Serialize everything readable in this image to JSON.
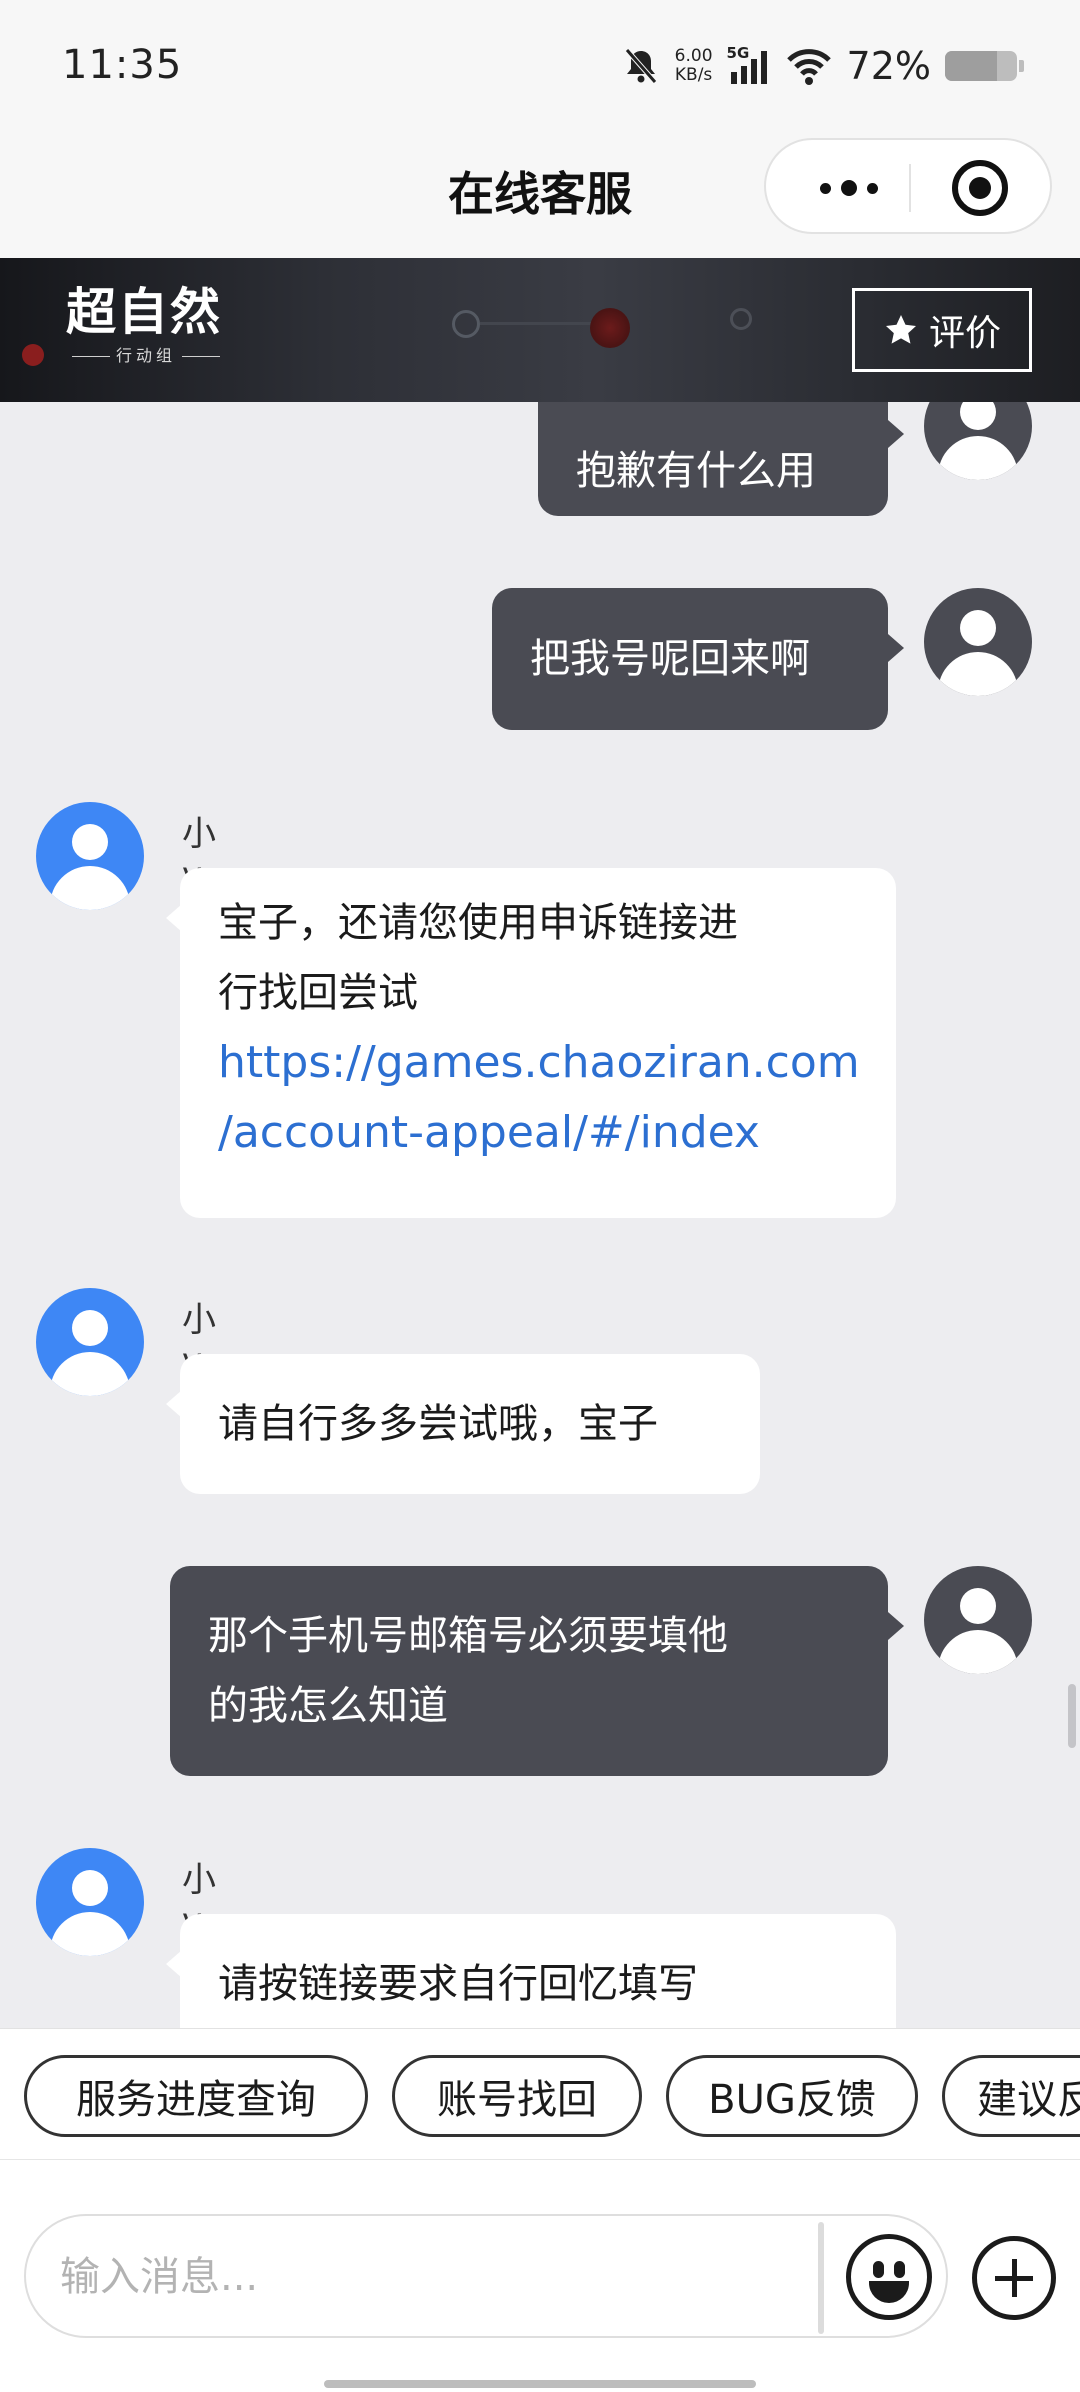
{
  "status_bar": {
    "time": "11:35",
    "net_speed_value": "6.00",
    "net_speed_unit": "KB/s",
    "network_type": "5G",
    "battery_percent_text": "72%",
    "battery_level": 0.72,
    "icons": [
      "mute-bell-icon",
      "signal-icon",
      "wifi-icon",
      "battery-icon"
    ]
  },
  "nav": {
    "title": "在线客服",
    "icons": [
      "more-dots-icon",
      "close-target-icon"
    ]
  },
  "banner": {
    "logo_text": "超自然",
    "logo_subtext": "行动组",
    "rate_label": "评价",
    "rate_icon": "star-icon"
  },
  "chat": {
    "messages": [
      {
        "from": "user",
        "text": "抱歉有什么用"
      },
      {
        "from": "user",
        "text": "把我号呢回来啊"
      },
      {
        "from": "agent",
        "sender": "小v",
        "lines": [
          "宝子，还请您使用申诉链接进",
          "行找回尝试"
        ],
        "link_lines": [
          "https://games.chaoziran.com",
          "/account-appeal/#/index"
        ]
      },
      {
        "from": "agent",
        "sender": "小v",
        "text": "请自行多多尝试哦，宝子"
      },
      {
        "from": "user",
        "lines": [
          "那个手机号邮箱号必须要填他",
          "的我怎么知道"
        ]
      },
      {
        "from": "agent",
        "sender": "小v",
        "text": "请按链接要求自行回忆填写"
      }
    ]
  },
  "quick_replies": [
    "服务进度查询",
    "账号找回",
    "BUG反馈",
    "建议反馈"
  ],
  "input": {
    "placeholder": "输入消息...",
    "value": "",
    "icons": [
      "emoji-icon",
      "plus-icon"
    ]
  }
}
